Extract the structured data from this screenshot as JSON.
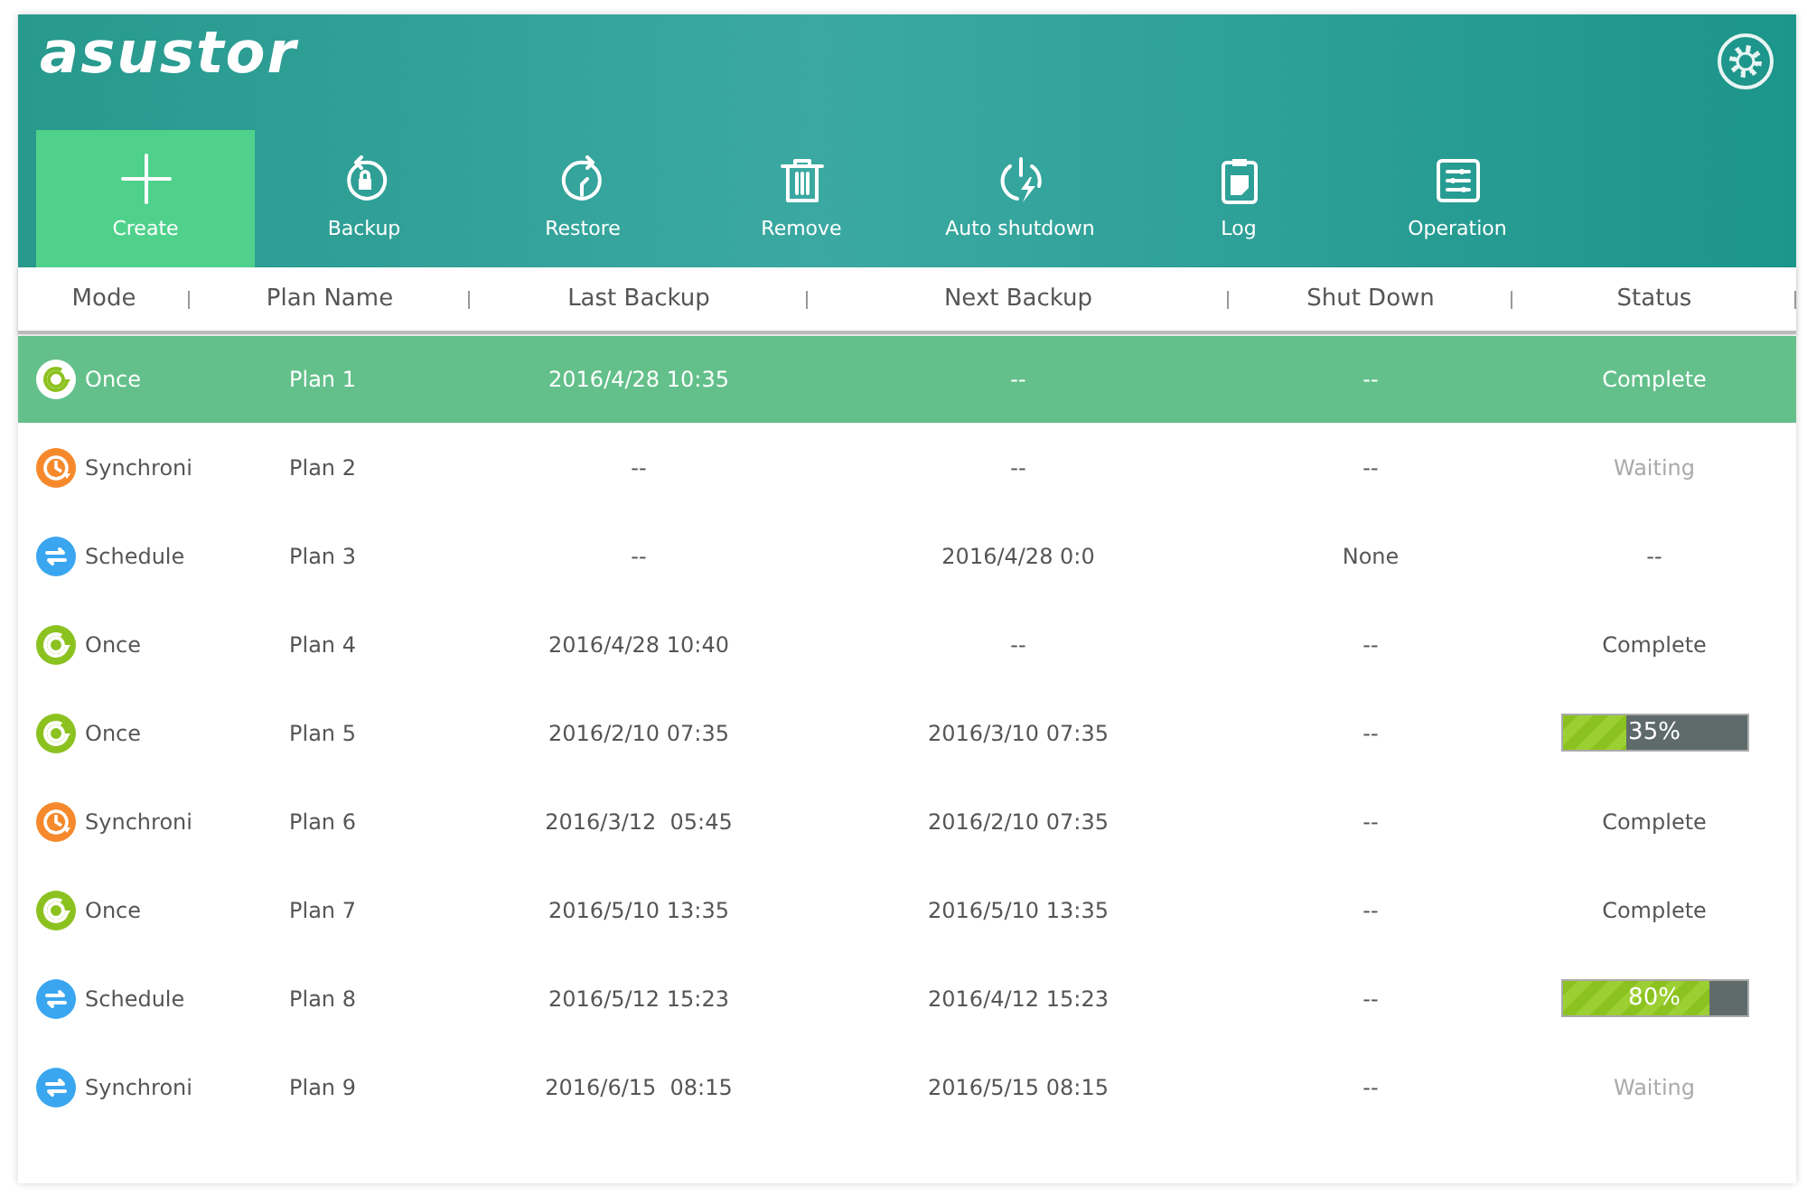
{
  "logo": "asustor",
  "toolbar": [
    {
      "label": "Create",
      "selected": true
    },
    {
      "label": "Backup",
      "selected": false
    },
    {
      "label": "Restore",
      "selected": false
    },
    {
      "label": "Remove",
      "selected": false
    },
    {
      "label": "Auto shutdown",
      "selected": false
    },
    {
      "label": "Log",
      "selected": false
    },
    {
      "label": "Operation",
      "selected": false
    }
  ],
  "table": {
    "columns": [
      "Mode",
      "Plan Name",
      "Last Backup",
      "Next Backup",
      "Shut Down",
      "Status"
    ],
    "rows": [
      {
        "selected": true,
        "mode": {
          "kind": "once",
          "label": "Once",
          "color": "#8cc21f"
        },
        "plan_name": "Plan 1",
        "last_backup": "2016/4/28 10:35",
        "next_backup": "--",
        "shut_down": "--",
        "status": {
          "kind": "text",
          "text": "Complete",
          "dimmed": false
        }
      },
      {
        "selected": false,
        "mode": {
          "kind": "clock",
          "label": "Synchroni",
          "color": "#f5892b"
        },
        "plan_name": "Plan 2",
        "last_backup": "--",
        "next_backup": "--",
        "shut_down": "--",
        "status": {
          "kind": "text",
          "text": "Waiting",
          "dimmed": true
        }
      },
      {
        "selected": false,
        "mode": {
          "kind": "sync",
          "label": "Schedule",
          "color": "#3aa6f0"
        },
        "plan_name": "Plan 3",
        "last_backup": "--",
        "next_backup": "2016/4/28 0:0",
        "shut_down": "None",
        "status": {
          "kind": "text",
          "text": "--",
          "dimmed": false
        }
      },
      {
        "selected": false,
        "mode": {
          "kind": "once",
          "label": "Once",
          "color": "#8cc21f"
        },
        "plan_name": "Plan 4",
        "last_backup": "2016/4/28 10:40",
        "next_backup": "--",
        "shut_down": "--",
        "status": {
          "kind": "text",
          "text": "Complete",
          "dimmed": false
        }
      },
      {
        "selected": false,
        "mode": {
          "kind": "once",
          "label": "Once",
          "color": "#8cc21f"
        },
        "plan_name": "Plan 5",
        "last_backup": "2016/2/10 07:35",
        "next_backup": "2016/3/10 07:35",
        "shut_down": "--",
        "status": {
          "kind": "progress",
          "text": "35%",
          "level": 0.35
        }
      },
      {
        "selected": false,
        "mode": {
          "kind": "clock",
          "label": "Synchroni",
          "color": "#f5892b"
        },
        "plan_name": "Plan 6",
        "last_backup": "2016/3/12  05:45",
        "next_backup": "2016/2/10 07:35",
        "shut_down": "--",
        "status": {
          "kind": "text",
          "text": "Complete",
          "dimmed": false
        }
      },
      {
        "selected": false,
        "mode": {
          "kind": "once",
          "label": "Once",
          "color": "#8cc21f"
        },
        "plan_name": "Plan 7",
        "last_backup": "2016/5/10 13:35",
        "next_backup": "2016/5/10 13:35",
        "shut_down": "--",
        "status": {
          "kind": "text",
          "text": "Complete",
          "dimmed": false
        }
      },
      {
        "selected": false,
        "mode": {
          "kind": "sync",
          "label": "Schedule",
          "color": "#3aa6f0"
        },
        "plan_name": "Plan 8",
        "last_backup": "2016/5/12 15:23",
        "next_backup": "2016/4/12 15:23",
        "shut_down": "--",
        "status": {
          "kind": "progress",
          "text": "80%",
          "level": 0.8
        }
      },
      {
        "selected": false,
        "mode": {
          "kind": "sync",
          "label": "Synchroni",
          "color": "#3aa6f0"
        },
        "plan_name": "Plan 9",
        "last_backup": "2016/6/15  08:15",
        "next_backup": "2016/5/15 08:15",
        "shut_down": "--",
        "status": {
          "kind": "text",
          "text": "Waiting",
          "dimmed": true
        }
      }
    ]
  }
}
